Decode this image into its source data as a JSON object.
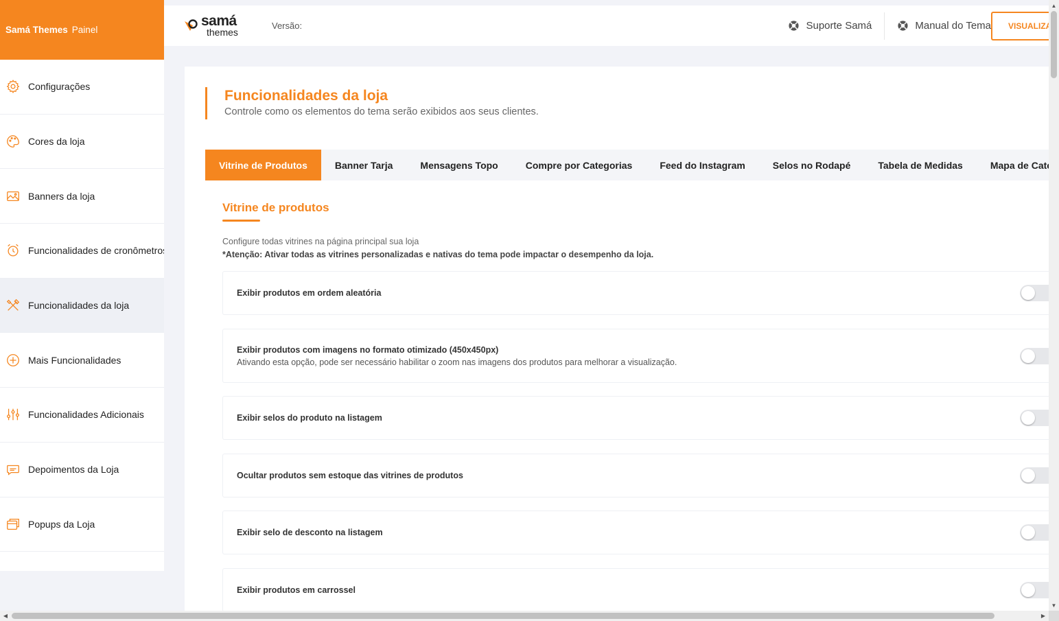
{
  "brand": {
    "name": "Samá Themes",
    "suffix": "Painel"
  },
  "sidebar": {
    "items": [
      {
        "label": "Configurações",
        "icon": "gear-icon"
      },
      {
        "label": "Cores da loja",
        "icon": "palette-icon"
      },
      {
        "label": "Banners da loja",
        "icon": "image-icon"
      },
      {
        "label": "Funcionalidades de cronômetros",
        "icon": "alarm-clock-icon"
      },
      {
        "label": "Funcionalidades da loja",
        "icon": "tools-icon",
        "active": true
      },
      {
        "label": "Mais Funcionalidades",
        "icon": "plus-circle-icon"
      },
      {
        "label": "Funcionalidades Adicionais",
        "icon": "sliders-icon"
      },
      {
        "label": "Depoimentos da Loja",
        "icon": "chat-bubble-icon"
      },
      {
        "label": "Popups da Loja",
        "icon": "popup-window-icon"
      }
    ]
  },
  "header": {
    "logo_line1": "samá",
    "logo_line2": "themes",
    "version_label": "Versão:",
    "support_link": "Suporte Samá",
    "manual_link": "Manual do Tema",
    "view_button": "VISUALIZAR"
  },
  "page": {
    "title": "Funcionalidades da loja",
    "subtitle": "Controle como os elementos do tema serão exibidos aos seus clientes."
  },
  "tabs": [
    {
      "label": "Vitrine de Produtos",
      "active": true
    },
    {
      "label": "Banner Tarja"
    },
    {
      "label": "Mensagens Topo"
    },
    {
      "label": "Compre por Categorias"
    },
    {
      "label": "Feed do Instagram"
    },
    {
      "label": "Selos no Rodapé"
    },
    {
      "label": "Tabela de Medidas"
    },
    {
      "label": "Mapa de Categorias"
    }
  ],
  "section": {
    "title": "Vitrine de produtos",
    "description": "Configure todas vitrines na página principal sua loja",
    "warning": "*Atenção: Ativar todas as vitrines personalizadas e nativas do tema pode impactar o desempenho da loja."
  },
  "options": [
    {
      "label": "Exibir produtos em ordem aleatória",
      "help": "",
      "enabled": false
    },
    {
      "label": "Exibir produtos com imagens no formato otimizado (450x450px)",
      "help": "Ativando esta opção, pode ser necessário habilitar o zoom nas imagens dos produtos para melhorar a visualização.",
      "enabled": false
    },
    {
      "label": "Exibir selos do produto na listagem",
      "help": "",
      "enabled": false
    },
    {
      "label": "Ocultar produtos sem estoque das vitrines de produtos",
      "help": "",
      "enabled": false
    },
    {
      "label": "Exibir selo de desconto na listagem",
      "help": "",
      "enabled": false
    },
    {
      "label": "Exibir produtos em carrossel",
      "help": "",
      "enabled": false
    }
  ],
  "colors": {
    "accent": "#f5861f",
    "background": "#f2f3f8"
  }
}
